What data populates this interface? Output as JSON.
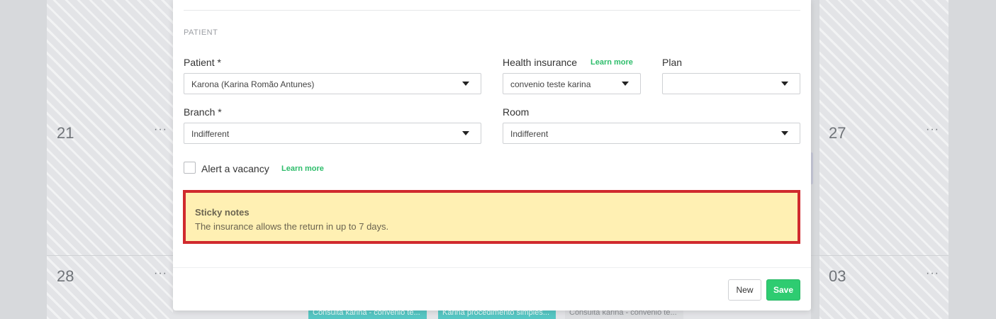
{
  "calendar": {
    "days": [
      {
        "number": "21"
      },
      {
        "number": "27"
      },
      {
        "number": "28"
      },
      {
        "number": "03"
      }
    ],
    "more_symbol": "···",
    "events": [
      {
        "label": "Consulta karina - convenio te..."
      },
      {
        "label": "Karina procedimento simples..."
      },
      {
        "label": "Consulta karina - convenio te..."
      }
    ]
  },
  "modal": {
    "section_title": "PATIENT",
    "patient": {
      "label": "Patient *",
      "value": "Karona (Karina Romão Antunes)"
    },
    "health_insurance": {
      "label": "Health insurance",
      "learn_more": "Learn more",
      "value": "convenio teste karina"
    },
    "plan": {
      "label": "Plan",
      "value": ""
    },
    "branch": {
      "label": "Branch *",
      "value": "Indifferent"
    },
    "room": {
      "label": "Room",
      "value": "Indifferent"
    },
    "alert_vacancy": {
      "label": "Alert a vacancy",
      "learn_more": "Learn more",
      "checked": false
    },
    "sticky_notes": {
      "title": "Sticky notes",
      "text": "The insurance allows the return in up to 7 days."
    },
    "buttons": {
      "new": "New",
      "save": "Save"
    }
  },
  "colors": {
    "accent_green": "#2ecc71",
    "learn_more_green": "#2ebd6b",
    "sticky_bg": "#fff0b3",
    "highlight_border": "#d02a2e",
    "event_teal": "#56c6c3"
  }
}
